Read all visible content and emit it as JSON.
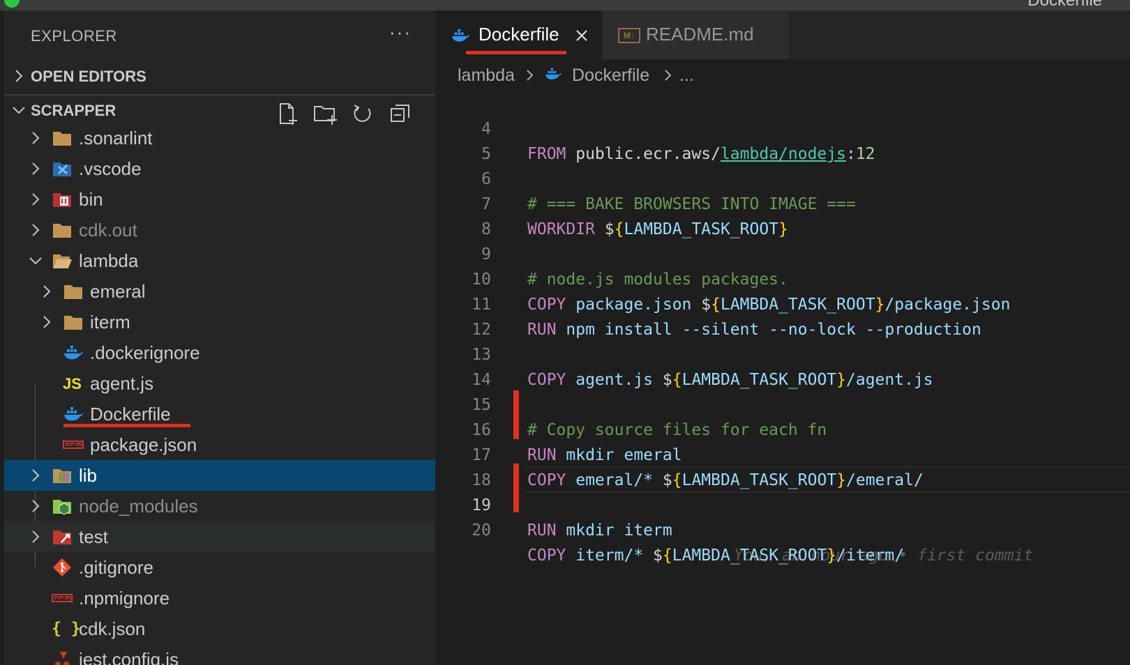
{
  "window": {
    "title": "Dockerfile"
  },
  "explorer": {
    "title": "EXPLORER",
    "more": "···",
    "open_editors": "OPEN EDITORS",
    "project": "SCRAPPER",
    "actions": [
      "new-file-icon",
      "new-folder-icon",
      "refresh-icon",
      "collapse-all-icon"
    ]
  },
  "tree": [
    {
      "name": ".sonarlint",
      "icon": "folder-icon"
    },
    {
      "name": ".vscode",
      "icon": "vscode-folder-icon"
    },
    {
      "name": "bin",
      "icon": "binary-folder-icon"
    },
    {
      "name": "cdk.out",
      "icon": "folder-icon"
    },
    {
      "name": "lambda",
      "icon": "folder-open-icon"
    },
    {
      "name": "emeral",
      "icon": "folder-icon"
    },
    {
      "name": "iterm",
      "icon": "folder-icon"
    },
    {
      "name": ".dockerignore",
      "icon": "docker-icon"
    },
    {
      "name": "agent.js",
      "icon": "javascript-icon",
      "icon_text": "JS"
    },
    {
      "name": "Dockerfile",
      "icon": "docker-icon"
    },
    {
      "name": "package.json",
      "icon": "npm-icon"
    },
    {
      "name": "lib",
      "icon": "library-folder-icon"
    },
    {
      "name": "node_modules",
      "icon": "node-folder-icon"
    },
    {
      "name": "test",
      "icon": "test-folder-icon"
    },
    {
      "name": ".gitignore",
      "icon": "git-icon"
    },
    {
      "name": ".npmignore",
      "icon": "npm-icon"
    },
    {
      "name": "cdk.json",
      "icon": "json-icon",
      "icon_text": "{ }"
    },
    {
      "name": "jest.config.js",
      "icon": "jest-icon"
    }
  ],
  "tabs": [
    {
      "label": "Dockerfile",
      "icon": "docker-icon",
      "active": true
    },
    {
      "label": "README.md",
      "icon": "markdown-icon",
      "icon_text": "M↓",
      "active": false
    }
  ],
  "breadcrumb": {
    "folder": "lambda",
    "file": "Dockerfile",
    "more": "..."
  },
  "code": {
    "lines": [
      {
        "n": "4",
        "c": "FROM public.ecr.aws/lambda/nodejs:12"
      },
      {
        "n": "5",
        "c": ""
      },
      {
        "n": "6",
        "c": "# === BAKE BROWSERS INTO IMAGE ==="
      },
      {
        "n": "7",
        "c": "WORKDIR ${LAMBDA_TASK_ROOT}"
      },
      {
        "n": "8",
        "c": ""
      },
      {
        "n": "9",
        "c": "# node.js modules packages."
      },
      {
        "n": "10",
        "c": "COPY package.json ${LAMBDA_TASK_ROOT}/package.json"
      },
      {
        "n": "11",
        "c": "RUN npm install --silent --no-lock --production"
      },
      {
        "n": "12",
        "c": ""
      },
      {
        "n": "13",
        "c": "COPY agent.js ${LAMBDA_TASK_ROOT}/agent.js"
      },
      {
        "n": "14",
        "c": ""
      },
      {
        "n": "15",
        "c": "# Copy source files for each fn"
      },
      {
        "n": "16",
        "c": "RUN mkdir emeral"
      },
      {
        "n": "17",
        "c": "COPY emeral/* ${LAMBDA_TASK_ROOT}/emeral/"
      },
      {
        "n": "18",
        "c": ""
      },
      {
        "n": "19",
        "c": "RUN mkdir iterm"
      },
      {
        "n": "20",
        "c": "COPY iterm/* ${LAMBDA_TASK_ROOT}/iterm/"
      }
    ],
    "current_line": "19",
    "blame": "You, an hour ago • first commit"
  },
  "colors": {
    "selection": "#094771",
    "annotation_red": "#e0301e",
    "keyword": "#c586c0",
    "variable": "#9cdcfe",
    "comment": "#6a9955",
    "brace": "#ffd700"
  }
}
